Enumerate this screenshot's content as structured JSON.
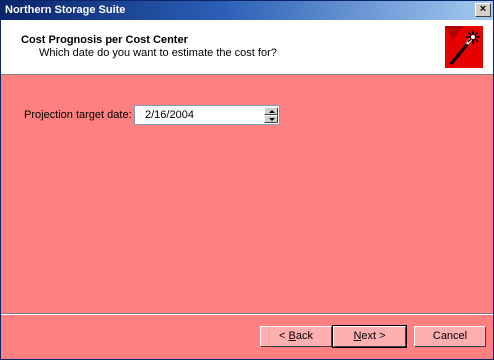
{
  "window": {
    "title": "Northern Storage Suite",
    "close_label": "×"
  },
  "header": {
    "title": "Cost Prognosis per Cost Center",
    "subtitle": "Which date do you want to estimate the cost for?",
    "icon": "wizard-wand-icon"
  },
  "form": {
    "projection_label": "Projection target date:",
    "projection_value": "2/16/2004"
  },
  "buttons": {
    "back_prefix": "< ",
    "back_mnemonic": "B",
    "back_rest": "ack",
    "next_mnemonic": "N",
    "next_rest": "ext >",
    "cancel": "Cancel"
  },
  "colors": {
    "body_bg": "#ff8080",
    "title_gradient_start": "#0a246a",
    "title_gradient_end": "#a6caf0"
  }
}
